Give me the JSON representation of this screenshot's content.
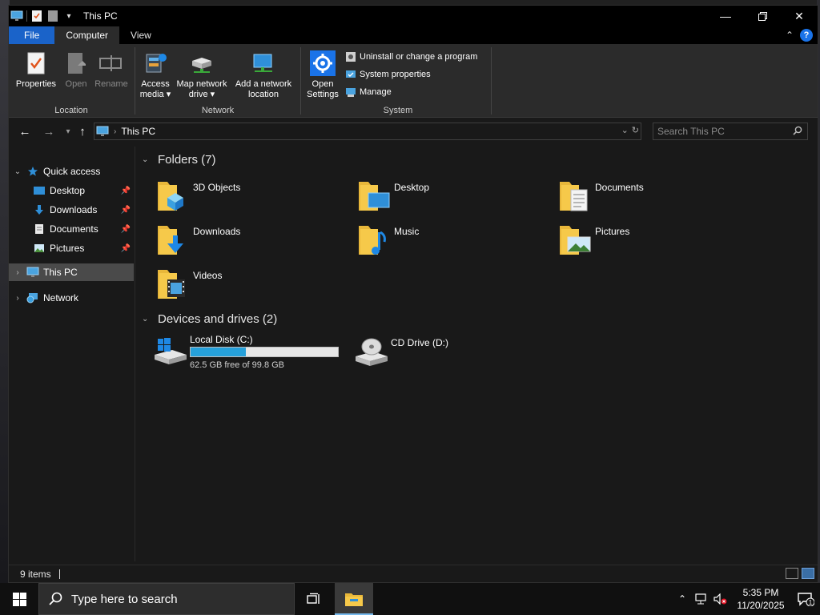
{
  "window": {
    "title": "This PC"
  },
  "ribbon_tabs": [
    {
      "label": "File"
    },
    {
      "label": "Computer"
    },
    {
      "label": "View"
    }
  ],
  "ribbon": {
    "location": {
      "label": "Location",
      "properties": "Properties",
      "open": "Open",
      "rename": "Rename"
    },
    "network": {
      "label": "Network",
      "access_media_1": "Access",
      "access_media_2": "media ▾",
      "map_drive_1": "Map network",
      "map_drive_2": "drive ▾",
      "add_location_1": "Add a network",
      "add_location_2": "location"
    },
    "system": {
      "label": "System",
      "open_settings_1": "Open",
      "open_settings_2": "Settings",
      "uninstall": "Uninstall or change a program",
      "system_properties": "System properties",
      "manage": "Manage"
    }
  },
  "address": {
    "path": "This PC",
    "search_placeholder": "Search This PC"
  },
  "sidebar": {
    "quick_access": "Quick access",
    "items": [
      {
        "label": "Desktop"
      },
      {
        "label": "Downloads"
      },
      {
        "label": "Documents"
      },
      {
        "label": "Pictures"
      }
    ],
    "this_pc": "This PC",
    "network": "Network"
  },
  "content": {
    "folders_header": "Folders (7)",
    "folders": [
      {
        "name": "3D Objects"
      },
      {
        "name": "Desktop"
      },
      {
        "name": "Documents"
      },
      {
        "name": "Downloads"
      },
      {
        "name": "Music"
      },
      {
        "name": "Pictures"
      },
      {
        "name": "Videos"
      }
    ],
    "devices_header": "Devices and drives (2)",
    "drives": [
      {
        "name": "Local Disk (C:)",
        "free_text": "62.5 GB free of 99.8 GB",
        "used_fraction": 0.374
      },
      {
        "name": "CD Drive (D:)"
      }
    ]
  },
  "status": {
    "item_count": "9 items"
  },
  "taskbar": {
    "search_placeholder": "Type here to search",
    "time": "5:35 PM",
    "date": "11/20/2025",
    "notification_count": "1"
  },
  "colors": {
    "accent": "#1a63c9",
    "usage_fill": "#26a0da",
    "folder_yellow": "#f6c94a"
  }
}
